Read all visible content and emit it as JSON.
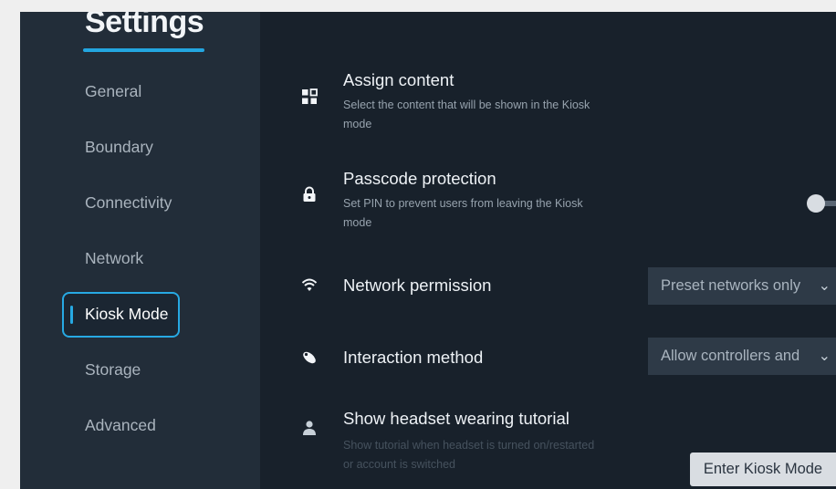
{
  "sidebar": {
    "title": "Settings",
    "items": [
      {
        "label": "General"
      },
      {
        "label": "Boundary"
      },
      {
        "label": "Connectivity"
      },
      {
        "label": "Network"
      },
      {
        "label": "Kiosk Mode",
        "active": true
      },
      {
        "label": "Storage"
      },
      {
        "label": "Advanced"
      }
    ]
  },
  "main": {
    "assign_content": {
      "icon": "grid-icon",
      "title": "Assign content",
      "desc_line1": "Select the content that will be shown in the Kiosk",
      "desc_line2": "mode"
    },
    "passcode": {
      "icon": "lock-icon",
      "title": "Passcode protection",
      "desc_line1": "Set PIN to prevent users from leaving the Kiosk",
      "desc_line2": "mode",
      "toggle_on": false
    },
    "network_permission": {
      "icon": "wifi-icon",
      "title": "Network permission",
      "value": "Preset networks only"
    },
    "interaction_method": {
      "icon": "controller-icon",
      "title": "Interaction method",
      "value": "Allow controllers and"
    },
    "tutorial": {
      "icon": "person-icon",
      "title": "Show headset wearing tutorial",
      "desc_line1": "Show tutorial when headset is turned on/restarted",
      "desc_line2": "or account is switched"
    },
    "enter_button": "Enter Kiosk Mode"
  },
  "colors": {
    "accent": "#27a9e3",
    "sidebar_bg": "#222d39",
    "main_bg": "#18212b"
  }
}
